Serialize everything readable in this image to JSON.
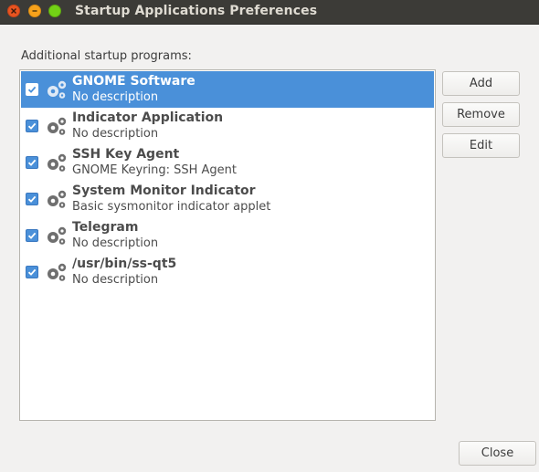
{
  "window": {
    "title": "Startup Applications Preferences"
  },
  "list": {
    "label": "Additional startup programs:",
    "items": [
      {
        "name": "GNOME Software",
        "description": "No description",
        "checked": true,
        "selected": true
      },
      {
        "name": "Indicator Application",
        "description": "No description",
        "checked": true,
        "selected": false
      },
      {
        "name": "SSH Key Agent",
        "description": "GNOME Keyring: SSH Agent",
        "checked": true,
        "selected": false
      },
      {
        "name": "System Monitor Indicator",
        "description": "Basic sysmonitor indicator applet",
        "checked": true,
        "selected": false
      },
      {
        "name": "Telegram",
        "description": "No description",
        "checked": true,
        "selected": false
      },
      {
        "name": "/usr/bin/ss-qt5",
        "description": "No description",
        "checked": true,
        "selected": false
      }
    ]
  },
  "buttons": {
    "add": "Add",
    "remove": "Remove",
    "edit": "Edit",
    "close": "Close"
  },
  "icons": {
    "app_icon": "gears-icon",
    "check": "check-icon"
  },
  "colors": {
    "selection": "#4a90d9",
    "titlebar": "#3c3b37",
    "close_button": "#e95420",
    "minimize_button": "#f7a21b",
    "maximize_button": "#73d216"
  }
}
